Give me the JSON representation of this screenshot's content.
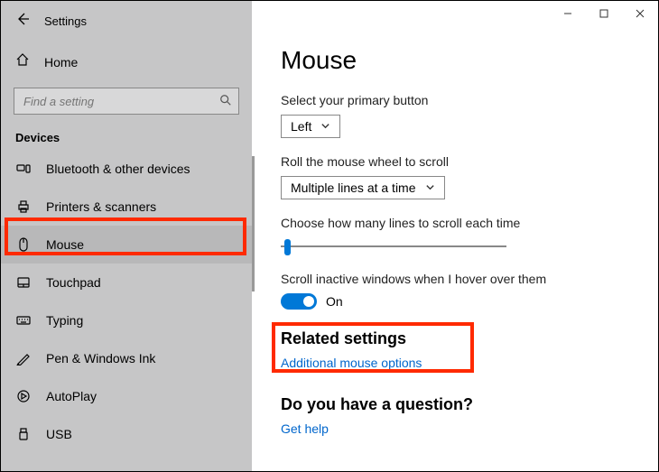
{
  "window": {
    "title": "Settings"
  },
  "sidebar": {
    "home": "Home",
    "search_placeholder": "Find a setting",
    "section": "Devices",
    "items": [
      {
        "icon": "bluetooth",
        "label": "Bluetooth & other devices"
      },
      {
        "icon": "printer",
        "label": "Printers & scanners"
      },
      {
        "icon": "mouse",
        "label": "Mouse",
        "selected": true
      },
      {
        "icon": "touchpad",
        "label": "Touchpad"
      },
      {
        "icon": "typing",
        "label": "Typing"
      },
      {
        "icon": "pen",
        "label": "Pen & Windows Ink"
      },
      {
        "icon": "autoplay",
        "label": "AutoPlay"
      },
      {
        "icon": "usb",
        "label": "USB"
      }
    ]
  },
  "main": {
    "page_title": "Mouse",
    "primary_button_label": "Select your primary button",
    "primary_button_value": "Left",
    "scroll_mode_label": "Roll the mouse wheel to scroll",
    "scroll_mode_value": "Multiple lines at a time",
    "lines_label": "Choose how many lines to scroll each time",
    "inactive_label": "Scroll inactive windows when I hover over them",
    "toggle_state": "On",
    "related_heading": "Related settings",
    "related_link": "Additional mouse options",
    "question_heading": "Do you have a question?",
    "help_link": "Get help"
  }
}
